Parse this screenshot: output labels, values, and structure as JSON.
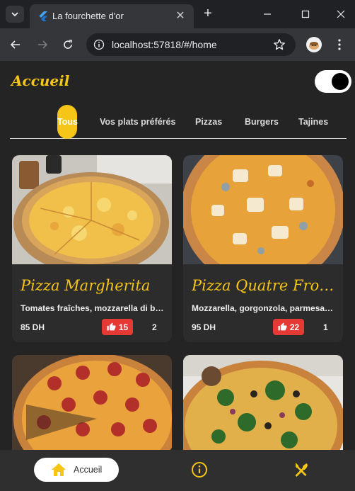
{
  "browser": {
    "tab_title": "La fourchette d'or",
    "url": "localhost:57818/#/home"
  },
  "app": {
    "title": "Accueil",
    "dark_mode": true,
    "accent_color": "#f5c518"
  },
  "categories": [
    {
      "label": "Tous",
      "active": true
    },
    {
      "label": "Vos plats préférés",
      "active": false
    },
    {
      "label": "Pizzas",
      "active": false
    },
    {
      "label": "Burgers",
      "active": false
    },
    {
      "label": "Tajines",
      "active": false
    }
  ],
  "dishes": [
    {
      "name": "Pizza Margherita",
      "description": "Tomates fraîches, mozzarella di bufala, basilic",
      "price": "85 DH",
      "likes": "15",
      "count": "2",
      "image": "pizza-margherita-photo"
    },
    {
      "name": "Pizza Quatre Fromages",
      "description": "Mozzarella, gorgonzola, parmesan, chèvre",
      "price": "95 DH",
      "likes": "22",
      "count": "1",
      "image": "pizza-quatre-fromages-photo"
    },
    {
      "name": "",
      "description": "",
      "price": "",
      "likes": "",
      "count": "",
      "image": "pizza-pepperoni-photo"
    },
    {
      "name": "",
      "description": "",
      "price": "",
      "likes": "",
      "count": "",
      "image": "pizza-vegetarienne-photo"
    }
  ],
  "bottom_nav": {
    "home_label": "Accueil",
    "items": [
      "home-icon",
      "info-icon",
      "restaurant-icon"
    ]
  }
}
